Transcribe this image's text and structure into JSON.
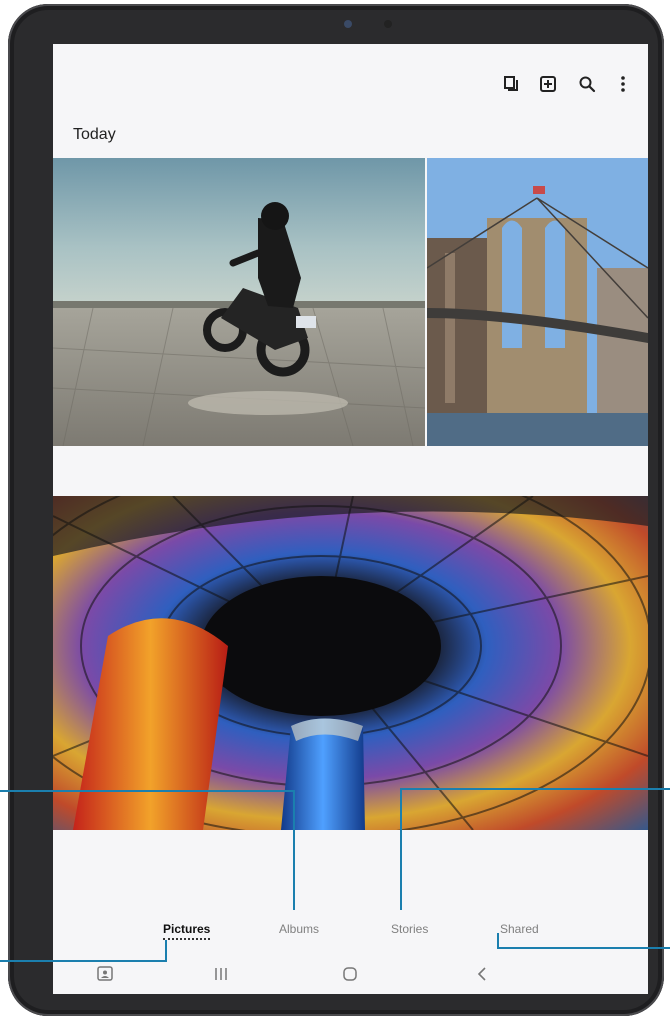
{
  "gallery": {
    "section_title": "Today",
    "tabs": [
      {
        "label": "Pictures",
        "active": true
      },
      {
        "label": "Albums",
        "active": false
      },
      {
        "label": "Stories",
        "active": false
      },
      {
        "label": "Shared",
        "active": false
      }
    ],
    "toolbar_icons": [
      "select-icon",
      "create-icon",
      "search-icon",
      "more-options-icon"
    ],
    "nav_icons": [
      "recent-apps-icon",
      "home-icon",
      "back-icon"
    ]
  },
  "colors": {
    "accent": "#1b7fae",
    "background": "#f6f6f8"
  }
}
